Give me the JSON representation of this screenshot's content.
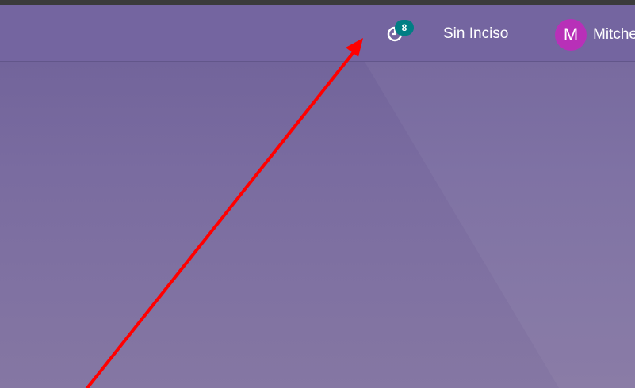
{
  "navbar": {
    "activity": {
      "icon": "clock-icon",
      "count": "8"
    },
    "company_name": "Sin Inciso",
    "user": {
      "avatar_initial": "M",
      "name": "Mitche",
      "avatar_color": "#b830b8"
    }
  },
  "colors": {
    "navbar_background": "#7465a0",
    "badge_background": "#017e84",
    "annotation_arrow": "#ff0000"
  }
}
